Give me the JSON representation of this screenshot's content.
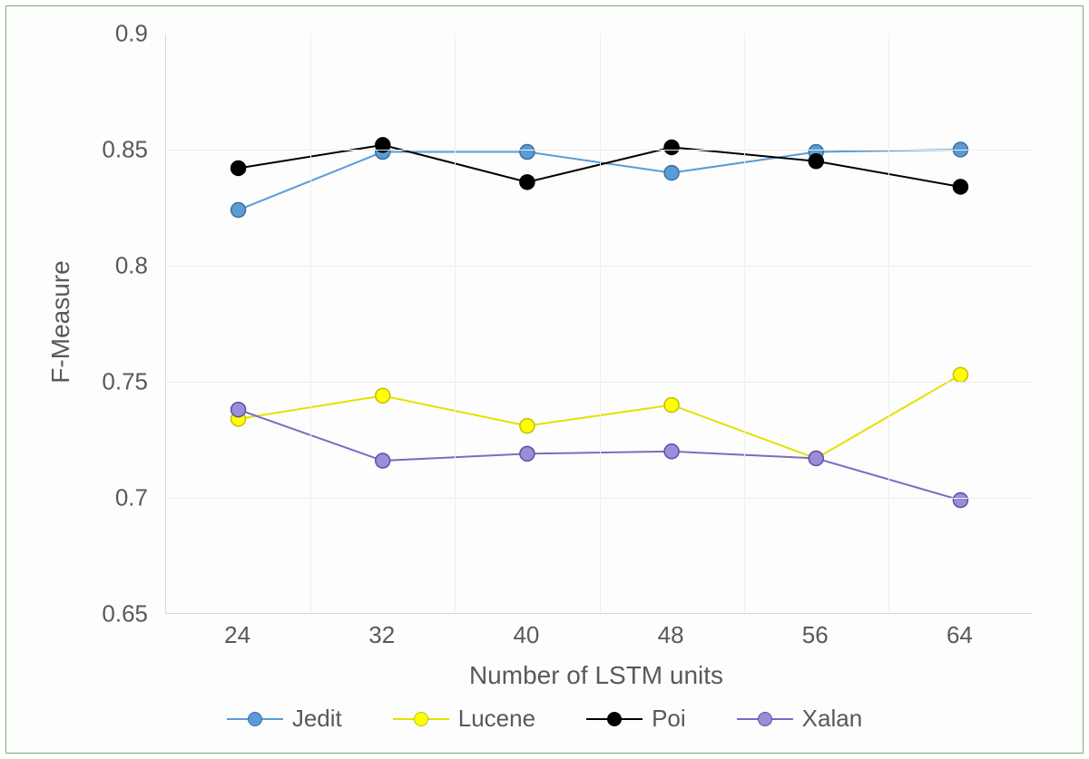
{
  "chart_data": {
    "type": "line",
    "title": "",
    "xlabel": "Number of LSTM units",
    "ylabel": "F-Measure",
    "ylim": [
      0.65,
      0.9
    ],
    "yticks": [
      0.65,
      0.7,
      0.75,
      0.8,
      0.85,
      0.9
    ],
    "categories": [
      24,
      32,
      40,
      48,
      56,
      64
    ],
    "legend_position": "bottom",
    "grid": true,
    "series": [
      {
        "name": "Jedit",
        "color_line": "#5b9bd5",
        "color_marker": "#5b9bd5",
        "marker_border": "#3c6f9b",
        "values": [
          0.824,
          0.849,
          0.849,
          0.84,
          0.849,
          0.85
        ]
      },
      {
        "name": "Lucene",
        "color_line": "#e6e000",
        "color_marker": "#ffff00",
        "marker_border": "#c4bd00",
        "values": [
          0.734,
          0.744,
          0.731,
          0.74,
          0.717,
          0.753
        ]
      },
      {
        "name": "Poi",
        "color_line": "#000000",
        "color_marker": "#000000",
        "marker_border": "#000000",
        "values": [
          0.842,
          0.852,
          0.836,
          0.851,
          0.845,
          0.834
        ]
      },
      {
        "name": "Xalan",
        "color_line": "#7c6bc0",
        "color_marker": "#9a8ed8",
        "marker_border": "#5f4ea6",
        "values": [
          0.738,
          0.716,
          0.719,
          0.72,
          0.717,
          0.699
        ]
      }
    ]
  }
}
